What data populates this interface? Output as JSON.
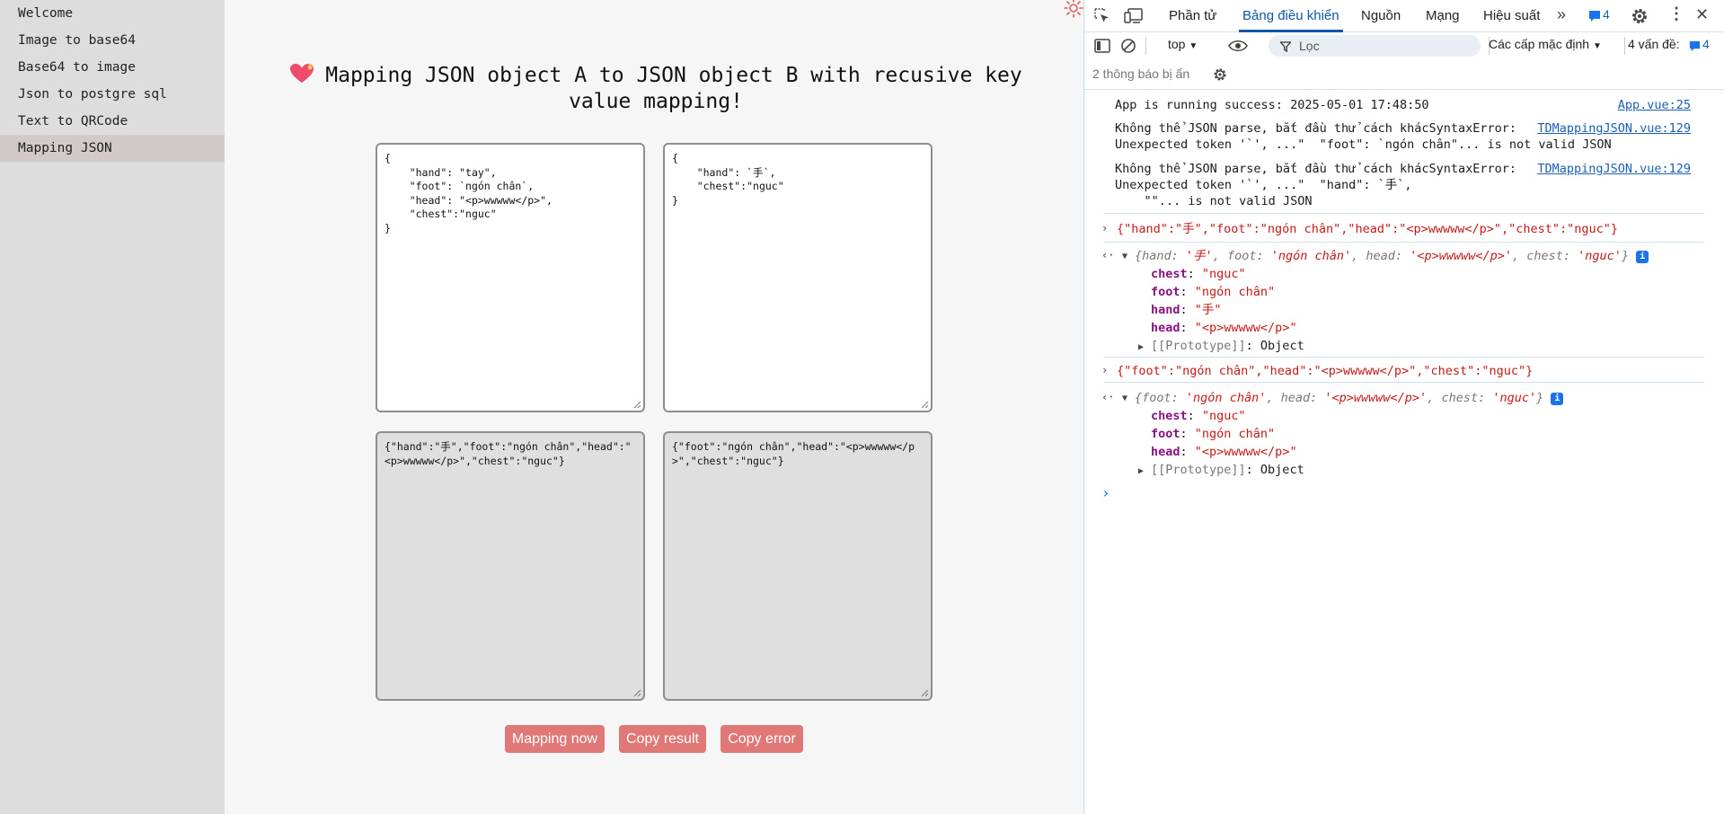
{
  "sidebar": {
    "items": [
      {
        "label": "Welcome"
      },
      {
        "label": "Image to base64"
      },
      {
        "label": "Base64 to image"
      },
      {
        "label": "Json to postgre sql"
      },
      {
        "label": "Text to QRCode"
      },
      {
        "label": "Mapping JSON"
      }
    ]
  },
  "main": {
    "title": "Mapping JSON object A to JSON object B with recusive key value mapping!",
    "json_a": "{\n    \"hand\": \"tay\",\n    \"foot\": `ngón chân`,\n    \"head\": \"<p>wwwww</p>\",\n    \"chest\":\"nguc\"\n}",
    "json_b": "{\n    \"hand\": `手`,\n    \"chest\":\"nguc\"\n}",
    "result_a": "{\"hand\":\"手\",\"foot\":\"ngón chân\",\"head\":\"<p>wwwww</p>\",\"chest\":\"nguc\"}",
    "result_b": "{\"foot\":\"ngón chân\",\"head\":\"<p>wwwww</p>\",\"chest\":\"nguc\"}",
    "buttons": {
      "mapping": "Mapping now",
      "copy_result": "Copy result",
      "copy_error": "Copy error"
    }
  },
  "devtools": {
    "tabs": [
      "Phần tử",
      "Bảng điều khiển",
      "Nguồn",
      "Mạng",
      "Hiệu suất"
    ],
    "active_tab": "Bảng điều khiển",
    "messages_badge": "4",
    "context": "top",
    "filter_placeholder": "Lọc",
    "levels": "Các cấp mặc định",
    "issues_label": "4 vấn đề:",
    "issues_count": "4",
    "hidden_msgs": "2 thông báo bị ẩn",
    "console": {
      "log1": "App is running success: 2025-05-01 17:48:50",
      "log1_src": "App.vue:25",
      "err1_line1": "Không thể JSON parse, bắt đầu thử cách khácSyntaxError:",
      "err1_line2": "Unexpected token '`', ...\"  \"foot\": `ngón chân\"... is not valid JSON",
      "err1_src": "TDMappingJSON.vue:129",
      "err2_line1": "Không thể JSON parse, bắt đầu thử cách khácSyntaxError:",
      "err2_line2": "Unexpected token '`', ...\"  \"hand\": `手`,",
      "err2_line3": "    \"\"... is not valid JSON",
      "err2_src": "TDMappingJSON.vue:129",
      "out1": "{\"hand\":\"手\",\"foot\":\"ngón chân\",\"head\":\"<p>wwwww</p>\",\"chest\":\"nguc\"}",
      "obj1_preview": {
        "open": "{",
        "hand_k": "hand",
        "hand_v": "'手'",
        "foot_k": "foot",
        "foot_v": "'ngón chân'",
        "head_k": "head",
        "head_v": "'<p>wwwww</p>'",
        "chest_k": "chest",
        "chest_v": "'nguc'",
        "close": "}"
      },
      "obj1_props": [
        {
          "k": "chest",
          "v": "\"nguc\""
        },
        {
          "k": "foot",
          "v": "\"ngón chân\""
        },
        {
          "k": "hand",
          "v": "\"手\""
        },
        {
          "k": "head",
          "v": "\"<p>wwwww</p>\""
        }
      ],
      "prototype": "[[Prototype]]",
      "prototype_val": ": Object",
      "out2": "{\"foot\":\"ngón chân\",\"head\":\"<p>wwwww</p>\",\"chest\":\"nguc\"}",
      "obj2_preview": {
        "foot_k": "foot",
        "foot_v": "'ngón chân'",
        "head_k": "head",
        "head_v": "'<p>wwwww</p>'",
        "chest_k": "chest",
        "chest_v": "'nguc'"
      },
      "obj2_props": [
        {
          "k": "chest",
          "v": "\"nguc\""
        },
        {
          "k": "foot",
          "v": "\"ngón chân\""
        },
        {
          "k": "head",
          "v": "\"<p>wwwww</p>\""
        }
      ],
      "info_badge": "i",
      "prompt": "›"
    }
  }
}
